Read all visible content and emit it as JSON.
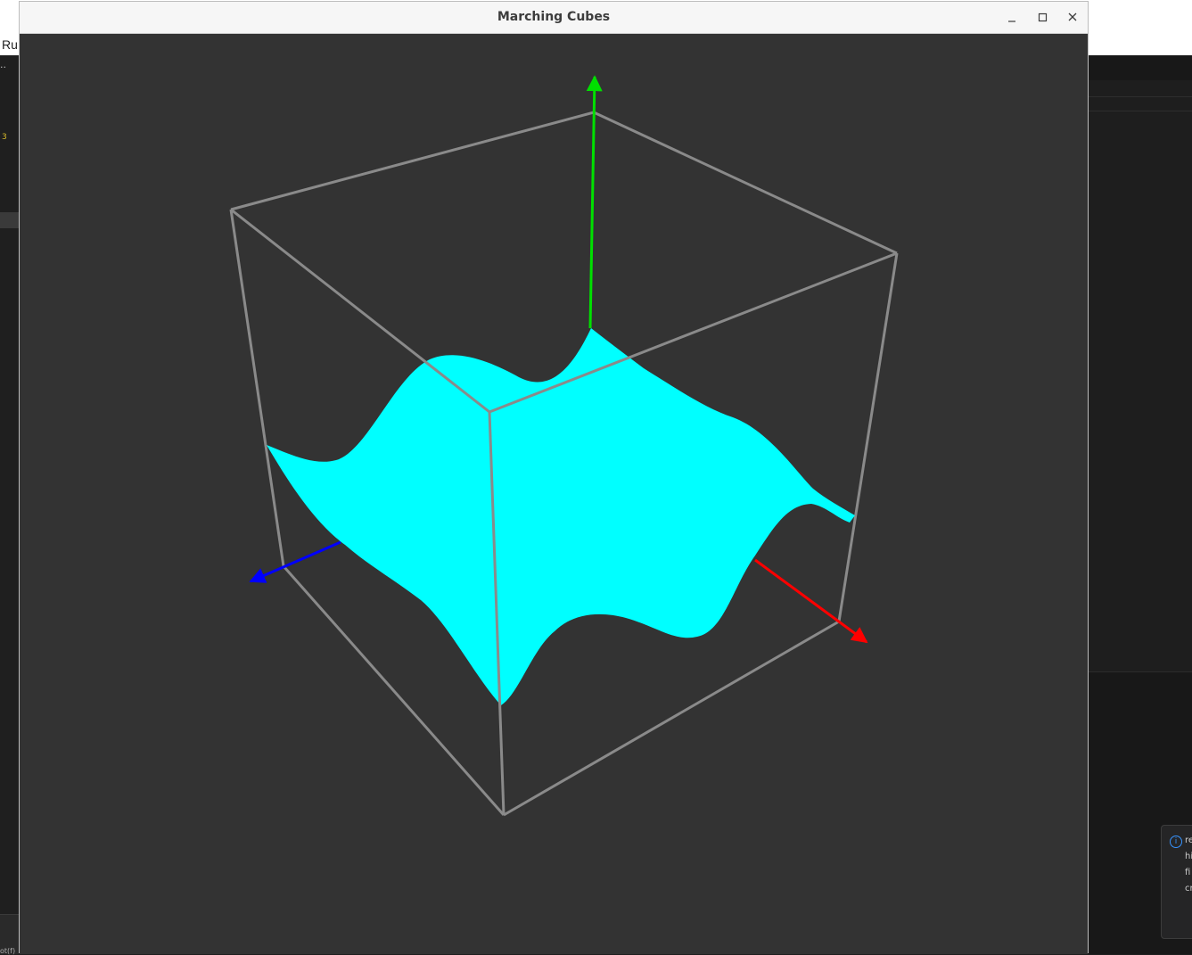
{
  "window": {
    "title": "Marching Cubes",
    "controls": {
      "minimize": "minimize-icon",
      "maximize": "maximize-icon",
      "close": "close-icon"
    }
  },
  "scene": {
    "background_color": "#333333",
    "bounding_box_color": "#8a8a8a",
    "surface_color": "#00ffff",
    "axes": [
      {
        "name": "x-axis",
        "color": "#ff0000"
      },
      {
        "name": "y-axis",
        "color": "#00e000"
      },
      {
        "name": "z-axis",
        "color": "#0000ff"
      }
    ]
  },
  "background_app": {
    "menu_partial": "Ru",
    "line_number_partial": "3",
    "notification_lines": [
      "re",
      "hi",
      "fi",
      "cr"
    ],
    "status_partial": "ot(f)"
  }
}
